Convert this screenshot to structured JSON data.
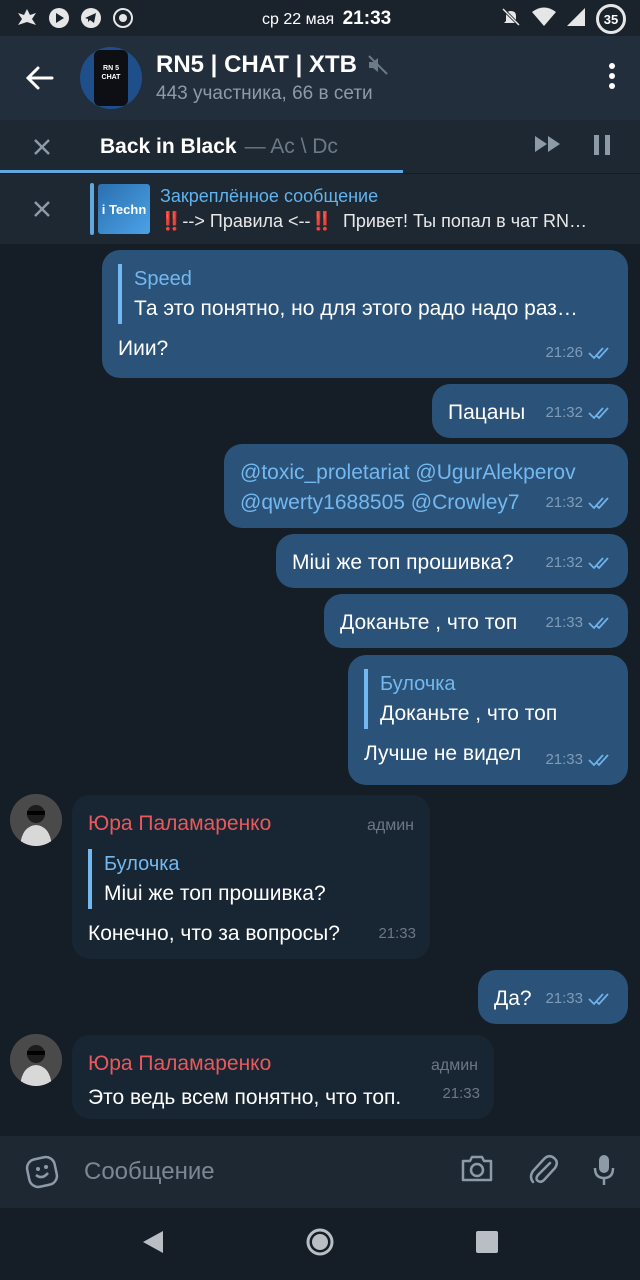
{
  "status_bar": {
    "date": "ср 22 мая",
    "time": "21:33",
    "battery": "35"
  },
  "header": {
    "title": "RN5 | CHAT | XTB",
    "subtitle": "443 участника, 66 в сети",
    "avatar_text_line1": "RN 5",
    "avatar_text_line2": "CHAT"
  },
  "music": {
    "title": "Back in Black",
    "artist": "— Ac \\ Dc",
    "progress": 0.63
  },
  "pinned": {
    "title": "Закреплённое сообщение",
    "thumb_text": "i Techn",
    "marker": "‼️",
    "text_part1": "--> Правила <--",
    "text_part2": "Привет! Ты попал в чат RN…"
  },
  "messages": [
    {
      "reply_name": "Speed",
      "reply_text": "Та это понятно, но для этого радо надо раз…",
      "text": "Иии?",
      "time": "21:26"
    },
    {
      "text": "Пацаны",
      "time": "21:32"
    },
    {
      "mentions_line1": "@toxic_proletariat @UgurAlekperov",
      "mentions_line2": "@qwerty1688505 @Crowley7",
      "time": "21:32"
    },
    {
      "text": "Miui же топ прошивка?",
      "time": "21:32"
    },
    {
      "text": "Доканьте , что топ",
      "time": "21:33"
    },
    {
      "reply_name": "Булочка",
      "reply_text": "Доканьте , что топ",
      "text": "Лучше не видел",
      "time": "21:33"
    },
    {
      "sender": "Юра Паламаренко",
      "role": "админ",
      "reply_name": "Булочка",
      "reply_text": "Miui же топ прошивка?",
      "text": "Конечно, что за вопросы?",
      "time": "21:33"
    },
    {
      "text": "Да?",
      "time": "21:33"
    },
    {
      "sender": "Юра Паламаренко",
      "role": "админ",
      "text": "Это ведь всем понятно, что топ.",
      "time": "21:33"
    }
  ],
  "input": {
    "placeholder": "Сообщение"
  },
  "colors": {
    "accent": "#5fa8e0",
    "outgoing_bubble": "#2b5278",
    "incoming_bubble": "#182533",
    "sender_name": "#e8595c",
    "background": "#151e27"
  }
}
